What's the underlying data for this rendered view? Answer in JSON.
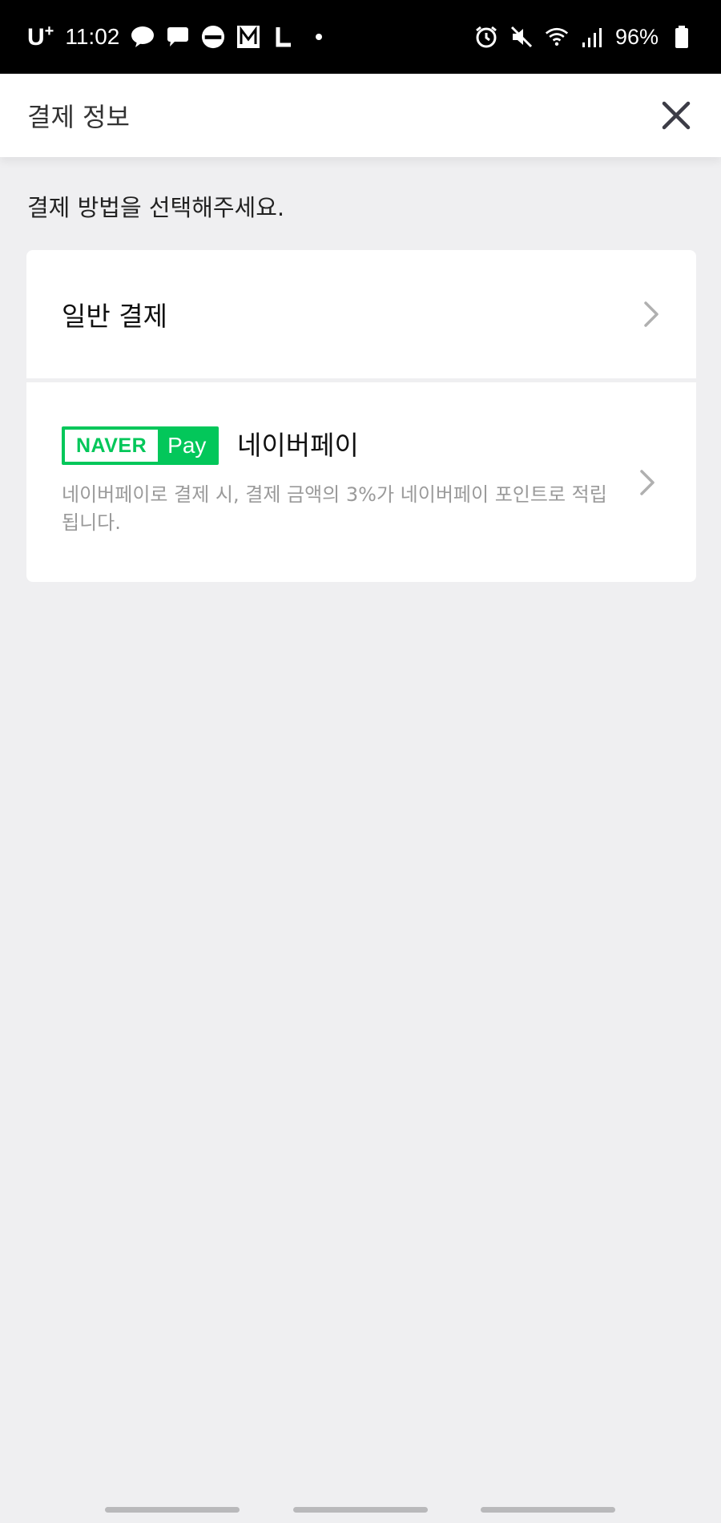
{
  "status_bar": {
    "carrier": "U",
    "carrier_suffix": "+",
    "time": "11:02",
    "battery": "96%"
  },
  "header": {
    "title": "결제 정보"
  },
  "instruction": "결제 방법을 선택해주세요.",
  "options": {
    "general": {
      "label": "일반 결제"
    },
    "naverpay": {
      "badge_naver": "NAVER",
      "badge_pay": "Pay",
      "label": "네이버페이",
      "description": "네이버페이로 결제 시, 결제 금액의 3%가 네이버페이 포인트로 적립됩니다."
    }
  },
  "colors": {
    "naver_green": "#03c75a",
    "background": "#efeff1"
  }
}
